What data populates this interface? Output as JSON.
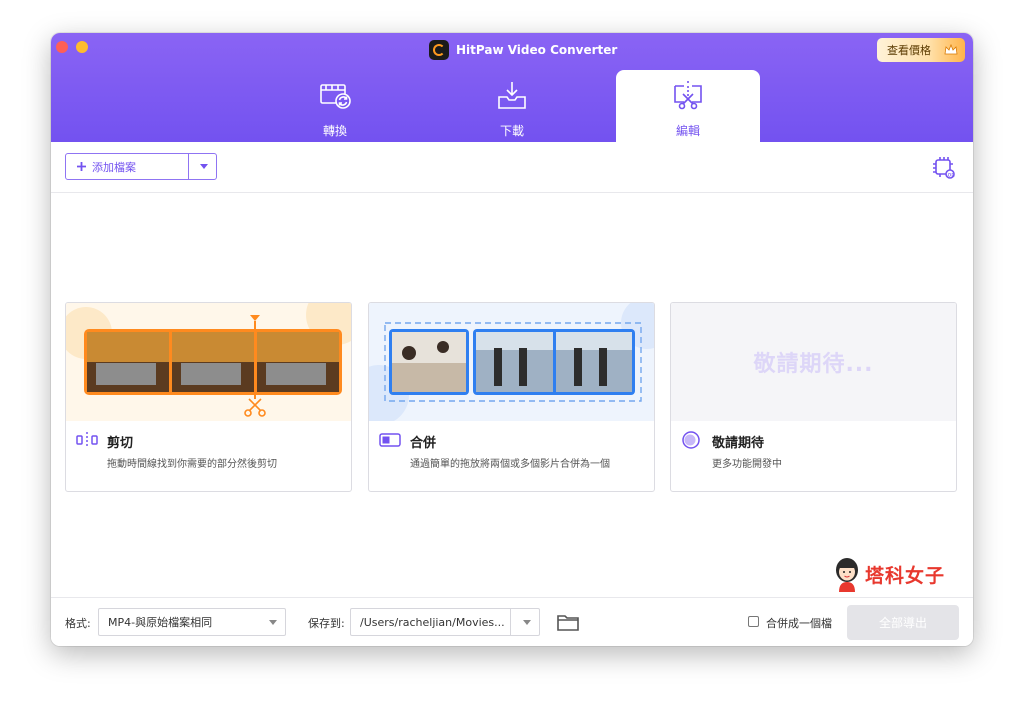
{
  "window": {
    "title": "HitPaw Video Converter",
    "pricing_label": "查看價格",
    "accent_color": "#7352f0"
  },
  "tabs": [
    {
      "label": "轉換",
      "icon": "film-convert-icon",
      "active": false
    },
    {
      "label": "下載",
      "icon": "download-tray-icon",
      "active": false
    },
    {
      "label": "編輯",
      "icon": "edit-cut-icon",
      "active": true
    }
  ],
  "toolbar": {
    "add_file_label": "添加檔案",
    "hardware_accel_icon": "hardware-acceleration-icon"
  },
  "cards": [
    {
      "title": "剪切",
      "desc": "拖動時間線找到你需要的部分然後剪切",
      "icon": "trim-icon"
    },
    {
      "title": "合併",
      "desc": "通過簡單的拖放將兩個或多個影片合併為一個",
      "icon": "merge-icon"
    },
    {
      "title": "敬請期待",
      "desc": "更多功能開發中",
      "banner_text": "敬請期待...",
      "icon": "coming-soon-icon"
    }
  ],
  "footer": {
    "format_label": "格式:",
    "format_value": "MP4-與原始檔案相同",
    "save_label": "保存到:",
    "save_path": "/Users/racheljian/Movies...",
    "merge_label": "合併成一個檔",
    "merge_checked": false,
    "export_label": "全部導出"
  },
  "watermark": {
    "text": "塔科女子"
  }
}
